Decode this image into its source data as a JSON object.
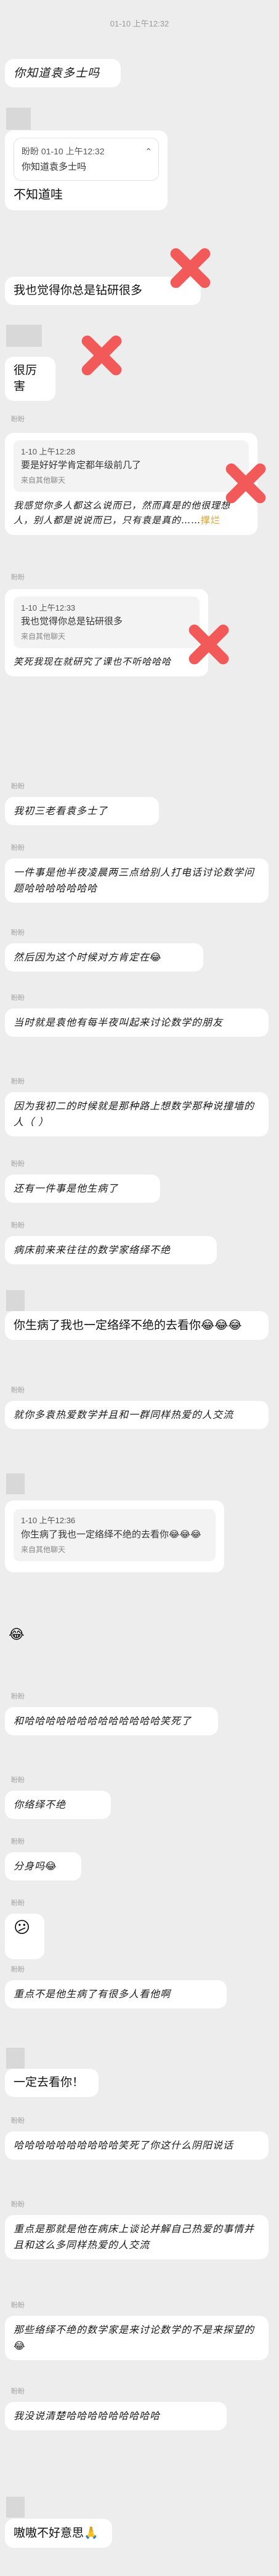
{
  "timestamp": "01-10 上午12:32",
  "sender_name": "盼盼",
  "messages": {
    "m1": "你知道袁多士吗",
    "q1_meta": "盼盼 01-10 上午12:32",
    "q1_text": "你知道袁多士吗",
    "m2": "不知道哇",
    "m3": "我也觉得你总是钻研很多",
    "m4": "很厉害",
    "q2_meta": "1-10 上午12:28",
    "q2_text": "要是好好学肯定都年级前几了",
    "q2_from": "来自其他聊天",
    "m5": "我感觉你多人都这么说而已，然而真是的他很理想人，别人都是说说而已，只有袁是真的……",
    "m5_tail": "撑烂",
    "q3_meta": "1-10 上午12:33",
    "q3_text": "我也觉得你总是钻研很多",
    "q3_from": "来自其他聊天",
    "m6": "笑死我现在就研究了课也不听哈哈哈",
    "m7": "我初三老看袁多士了",
    "m8": "一件事是他半夜凌晨两三点给别人打电话讨论数学问题哈哈哈哈哈哈哈",
    "m9": "然后因为这个时候对方肯定在",
    "m9_emoji": "😂",
    "m10": "当时就是袁他有每半夜叫起来讨论数学的朋友",
    "m11": "因为我初二的时候就是那种路上想数学那种说撞墙的人（ ）",
    "m12": "还有一件事是他生病了",
    "m13": "病床前来来往往的数学家络绎不绝",
    "m14": "你生病了我也一定络绎不绝的去看你",
    "m14_emoji": "😂😂😂",
    "m15": "就你多袁热爱数学并且和一群同样热爱的人交流",
    "q4_meta": "1-10 上午12:36",
    "q4_text": "你生病了我也一定络绎不绝的去看你",
    "q4_emoji": "😂😂😂",
    "q4_from": "来自其他聊天",
    "m16_emoji": "😂",
    "m17": "和哈哈哈哈哈哈哈哈哈哈哈哈哈笑死了",
    "m18": "你络绎不绝",
    "m19": "分身吗",
    "m19_emoji": "😂",
    "m20_emoji": "😕",
    "m21": "重点不是他生病了有很多人看他啊",
    "m22": "一定去看你！",
    "m23": "哈哈哈哈哈哈哈哈哈哈笑死了你这什么阴阳说话",
    "m24": "重点是那就是他在病床上谈论并解自己热爱的事情并且和这么多同样热爱的人交流",
    "m25": "那些络绎不绝的数学家是来讨论数学的不是来探望的",
    "m25_emoji": "😂",
    "m26": "我没说清楚哈哈哈哈哈哈哈哈哈",
    "m27": "嗷嗷不好意思",
    "m27_emoji": "🙏"
  },
  "colors": {
    "background": "#ededed",
    "bubble": "#ffffff",
    "x_mark": "#f25a5a",
    "tail_link": "#e0a020"
  },
  "icons": {
    "x_mark": "red-x-icon",
    "quote_menu": "chevron-icon"
  }
}
